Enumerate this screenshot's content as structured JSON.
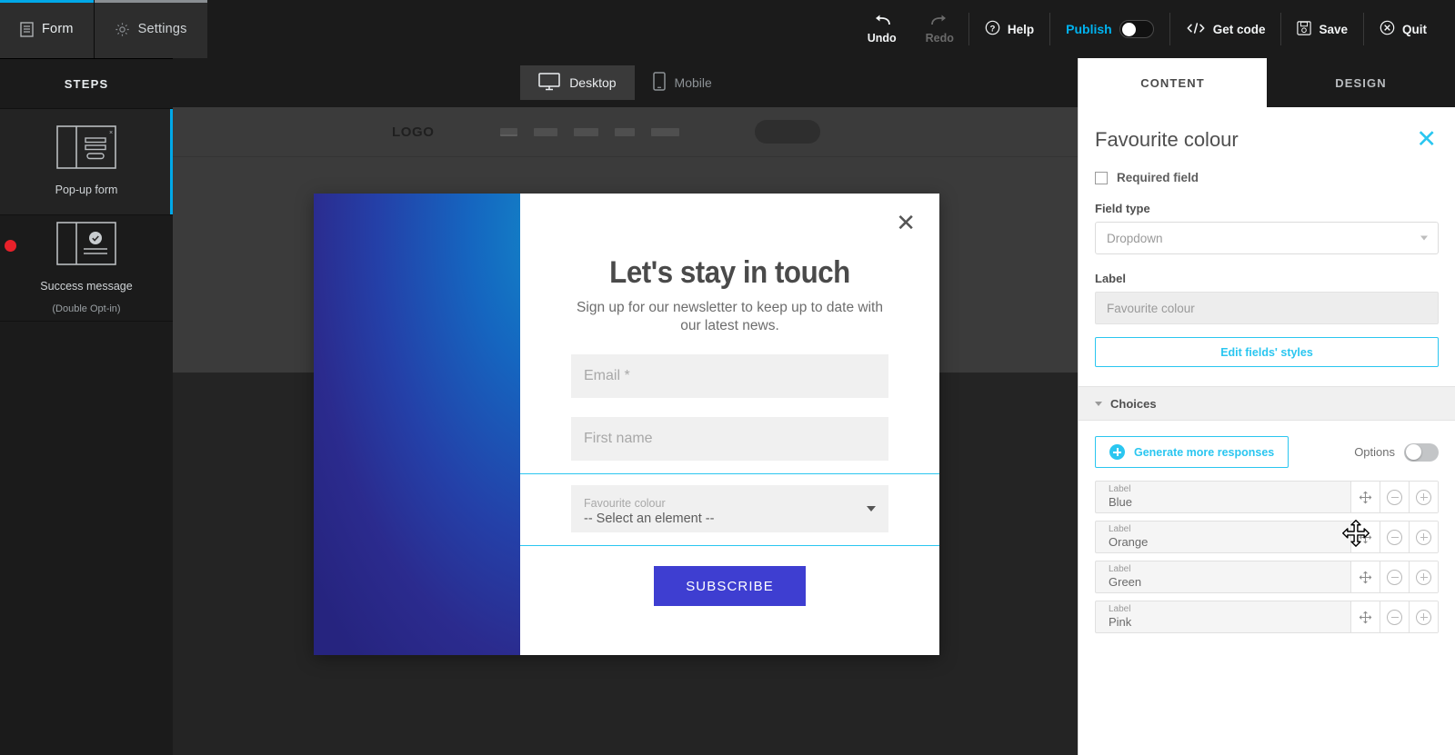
{
  "topbar": {
    "tabs": [
      {
        "label": "Form",
        "icon": "document-icon",
        "active": true
      },
      {
        "label": "Settings",
        "icon": "gear-icon",
        "active": false
      }
    ],
    "undo": "Undo",
    "redo": "Redo",
    "help": "Help",
    "publish": "Publish",
    "publish_toggle": "off",
    "get_code": "Get code",
    "save": "Save",
    "quit": "Quit",
    "accent": "#00b3ef"
  },
  "steps": {
    "title": "STEPS",
    "items": [
      {
        "label": "Pop-up form",
        "sublabel": "",
        "active": true,
        "has_alert": false
      },
      {
        "label": "Success message",
        "sublabel": "(Double Opt-in)",
        "active": false,
        "has_alert": true
      }
    ]
  },
  "canvas": {
    "devices": [
      {
        "label": "Desktop",
        "icon": "monitor-icon",
        "active": true
      },
      {
        "label": "Mobile",
        "icon": "phone-icon",
        "active": false
      }
    ],
    "mock_site": {
      "logo": "LOGO"
    },
    "popup": {
      "close_icon": "close-icon",
      "title": "Let's stay in touch",
      "subtitle": "Sign up for our newsletter to keep up to date with our latest news.",
      "fields": [
        {
          "placeholder": "Email *",
          "type": "text"
        },
        {
          "placeholder": "First name",
          "type": "text"
        }
      ],
      "dropdown": {
        "label": "Favourite colour",
        "value": "-- Select an element --",
        "selected": true
      },
      "submit_label": "SUBSCRIBE",
      "submit_color": "#3e3ed1"
    }
  },
  "right_panel": {
    "tabs": [
      {
        "label": "CONTENT",
        "active": true
      },
      {
        "label": "DESIGN",
        "active": false
      }
    ],
    "title": "Favourite colour",
    "close_icon": "close-icon",
    "required_field": {
      "label": "Required field",
      "checked": false
    },
    "field_type": {
      "label": "Field type",
      "value": "Dropdown"
    },
    "label_field": {
      "label": "Label",
      "value": "Favourite colour"
    },
    "edit_styles_label": "Edit fields' styles",
    "choices_section": {
      "title": "Choices",
      "generate_label": "Generate more responses",
      "options_label": "Options",
      "options_toggle": "off",
      "rows": [
        {
          "mini": "Label",
          "value": "Blue"
        },
        {
          "mini": "Label",
          "value": "Orange"
        },
        {
          "mini": "Label",
          "value": "Green"
        },
        {
          "mini": "Label",
          "value": "Pink"
        }
      ]
    },
    "accent": "#2ac6f0"
  }
}
